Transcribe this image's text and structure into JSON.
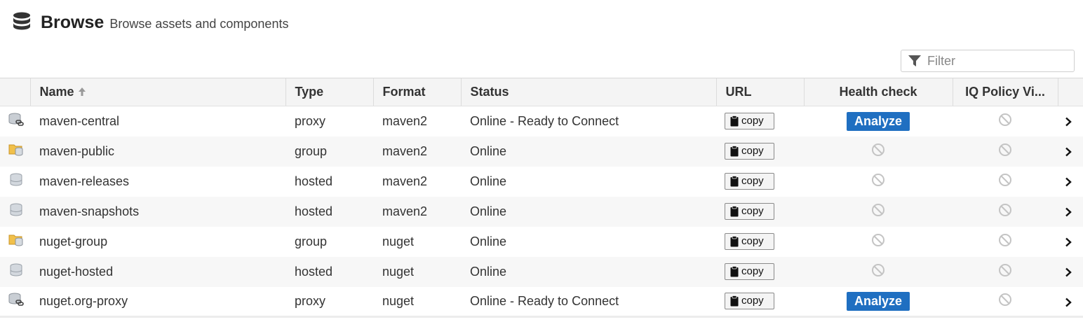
{
  "header": {
    "title": "Browse",
    "subtitle": "Browse assets and components",
    "icon": "database-icon"
  },
  "filter": {
    "placeholder": "Filter",
    "icon": "funnel-icon"
  },
  "columns": {
    "name": "Name",
    "type": "Type",
    "format": "Format",
    "status": "Status",
    "url": "URL",
    "health": "Health check",
    "iq": "IQ Policy Vi..."
  },
  "copy_label": "copy",
  "analyze_label": "Analyze",
  "colors": {
    "analyze": "#1f6fc1",
    "folder": "#f1c04a",
    "db": "#b8bec6"
  },
  "rows": [
    {
      "name": "maven-central",
      "type": "proxy",
      "format": "maven2",
      "status": "Online - Ready to Connect",
      "icon": "proxy-repo-icon",
      "health": "analyze"
    },
    {
      "name": "maven-public",
      "type": "group",
      "format": "maven2",
      "status": "Online",
      "icon": "group-repo-icon",
      "health": "disabled"
    },
    {
      "name": "maven-releases",
      "type": "hosted",
      "format": "maven2",
      "status": "Online",
      "icon": "hosted-repo-icon",
      "health": "disabled"
    },
    {
      "name": "maven-snapshots",
      "type": "hosted",
      "format": "maven2",
      "status": "Online",
      "icon": "hosted-repo-icon",
      "health": "disabled"
    },
    {
      "name": "nuget-group",
      "type": "group",
      "format": "nuget",
      "status": "Online",
      "icon": "group-repo-icon",
      "health": "disabled"
    },
    {
      "name": "nuget-hosted",
      "type": "hosted",
      "format": "nuget",
      "status": "Online",
      "icon": "hosted-repo-icon",
      "health": "disabled"
    },
    {
      "name": "nuget.org-proxy",
      "type": "proxy",
      "format": "nuget",
      "status": "Online - Ready to Connect",
      "icon": "proxy-repo-icon",
      "health": "analyze"
    }
  ]
}
